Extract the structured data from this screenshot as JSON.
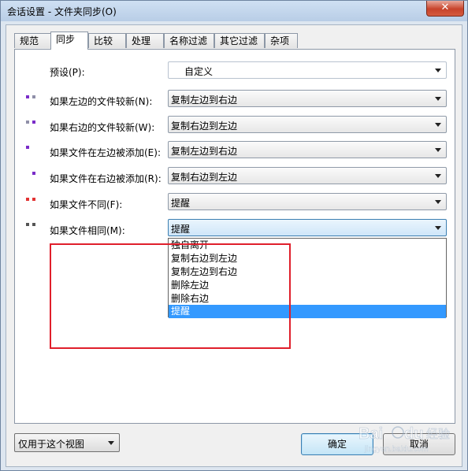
{
  "window": {
    "title": "会话设置 - 文件夹同步(O)",
    "close_label": "✕"
  },
  "tabs": [
    {
      "label": "规范"
    },
    {
      "label": "同步"
    },
    {
      "label": "比较"
    },
    {
      "label": "处理"
    },
    {
      "label": "名称过滤"
    },
    {
      "label": "其它过滤"
    },
    {
      "label": "杂项"
    }
  ],
  "active_tab": "同步",
  "preset": {
    "label": "预设(P):",
    "value": "自定义"
  },
  "rules": [
    {
      "label": "如果左边的文件较新(N):",
      "value": "复制左边到右边",
      "dot_colors": [
        "#7a2cc8",
        "#8f8fa8"
      ]
    },
    {
      "label": "如果右边的文件较新(W):",
      "value": "复制右边到左边",
      "dot_colors": [
        "#8f8fa8",
        "#7a2cc8"
      ]
    },
    {
      "label": "如果文件在左边被添加(E):",
      "value": "复制左边到右边",
      "dot_colors": [
        "#7a2cc8"
      ]
    },
    {
      "label": "如果文件在右边被添加(R):",
      "value": "复制右边到左边",
      "dot_colors": [
        "#7a2cc8"
      ]
    },
    {
      "label": "如果文件不同(F):",
      "value": "提醒",
      "dot_colors": [
        "#e23232",
        "#e23232"
      ]
    },
    {
      "label": "如果文件相同(M):",
      "value": "提醒",
      "dot_colors": [
        "#555555",
        "#555555"
      ]
    }
  ],
  "dropdown_options": [
    "独自离开",
    "复制右边到左边",
    "复制左边到右边",
    "删除左边",
    "删除右边",
    "提醒"
  ],
  "dropdown_selected": "提醒",
  "scope": {
    "value": "仅用于这个视图"
  },
  "buttons": {
    "ok": "确定",
    "cancel": "取消"
  },
  "watermark": {
    "brand": "Bai",
    "du": "du",
    "site": "经验",
    "url": "jingyan.baidu.com"
  },
  "colors": {
    "accent": "#3399ff",
    "highlight_box": "#e01f2b"
  }
}
